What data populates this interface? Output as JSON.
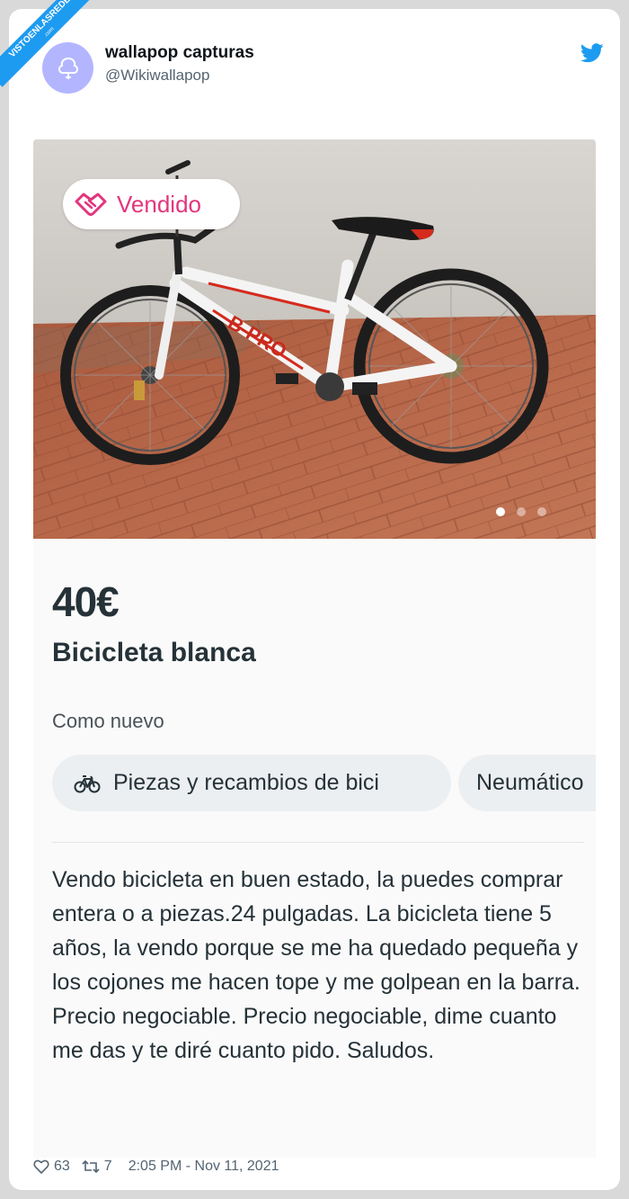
{
  "watermark": {
    "text": "VISTOENLASREDES",
    "subtext": ".com"
  },
  "tweet": {
    "display_name": "wallapop capturas",
    "handle": "@Wikiwallapop",
    "likes": "63",
    "retweets": "7",
    "timestamp": "2:05 PM - Nov 11, 2021"
  },
  "listing": {
    "sold_badge": "Vendido",
    "price": "40€",
    "title": "Bicicleta blanca",
    "condition": "Como nuevo",
    "categories": [
      "Piezas y recambios de bici",
      "Neumático"
    ],
    "description": "Vendo bicicleta en buen estado, la puedes comprar entera o a piezas.24 pulgadas. La bicicleta tiene 5 años, la vendo porque se me ha quedado pequeña y los cojones me hacen tope y me golpean en la barra. Precio negociable. Precio negociable, dime cuanto me das y te diré cuanto pido. Saludos.",
    "photo_count": 3,
    "active_photo": 1
  },
  "colors": {
    "twitter_blue": "#1d9bf0",
    "wallapop_pink": "#e3357d",
    "text_dark": "#253238",
    "avatar_bg": "#b3b6ff"
  }
}
